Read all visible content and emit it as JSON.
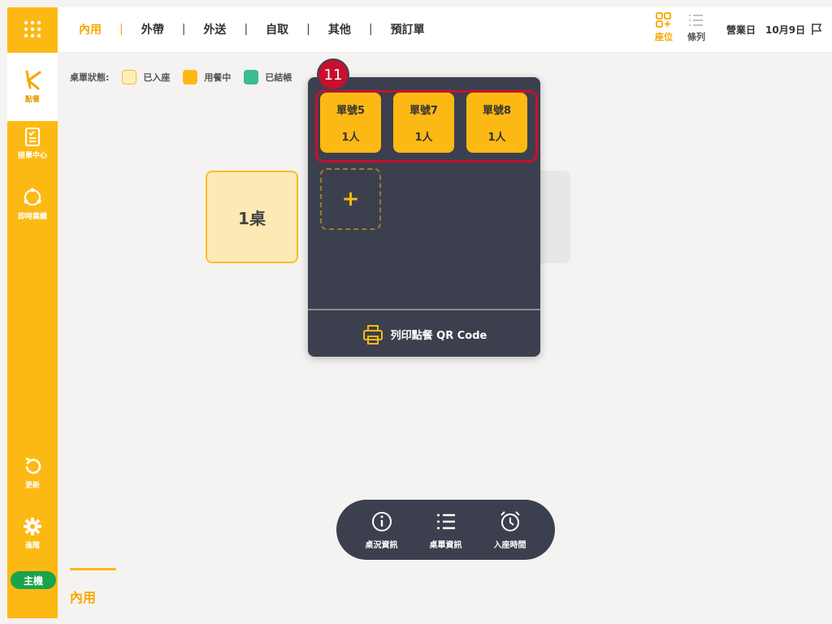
{
  "sidebar": {
    "items": [
      {
        "label": "點餐"
      },
      {
        "label": "接單中心"
      },
      {
        "label": "即時業績"
      },
      {
        "label": "更新"
      },
      {
        "label": "進階"
      }
    ],
    "host_label": "主機"
  },
  "topbar": {
    "tabs": [
      {
        "label": "內用"
      },
      {
        "label": "外帶"
      },
      {
        "label": "外送"
      },
      {
        "label": "自取"
      },
      {
        "label": "其他"
      },
      {
        "label": "預訂單"
      }
    ],
    "separator": "|",
    "view_seat": "座位",
    "view_list": "條列",
    "business_day_label": "營業日",
    "business_date": "10月9日"
  },
  "legend": {
    "title": "桌單狀態:",
    "items": [
      {
        "label": "已入座",
        "color": "#fdeebd"
      },
      {
        "label": "用餐中",
        "color": "#fdb913"
      },
      {
        "label": "已結帳",
        "color": "#3dbb93"
      }
    ]
  },
  "table": {
    "label": "1桌"
  },
  "popup": {
    "badge": "11",
    "orders": [
      {
        "title": "單號5",
        "count": "1人"
      },
      {
        "title": "單號7",
        "count": "1人"
      },
      {
        "title": "單號8",
        "count": "1人"
      }
    ],
    "add": "+",
    "print_label": "列印點餐 QR Code"
  },
  "bottom_bar": {
    "items": [
      {
        "label": "桌況資訊"
      },
      {
        "label": "桌單資訊"
      },
      {
        "label": "入座時間"
      }
    ]
  },
  "mode_label": "內用",
  "colors": {
    "accent": "#fdb913",
    "dark": "#3c404e",
    "highlight": "#c8102e"
  }
}
